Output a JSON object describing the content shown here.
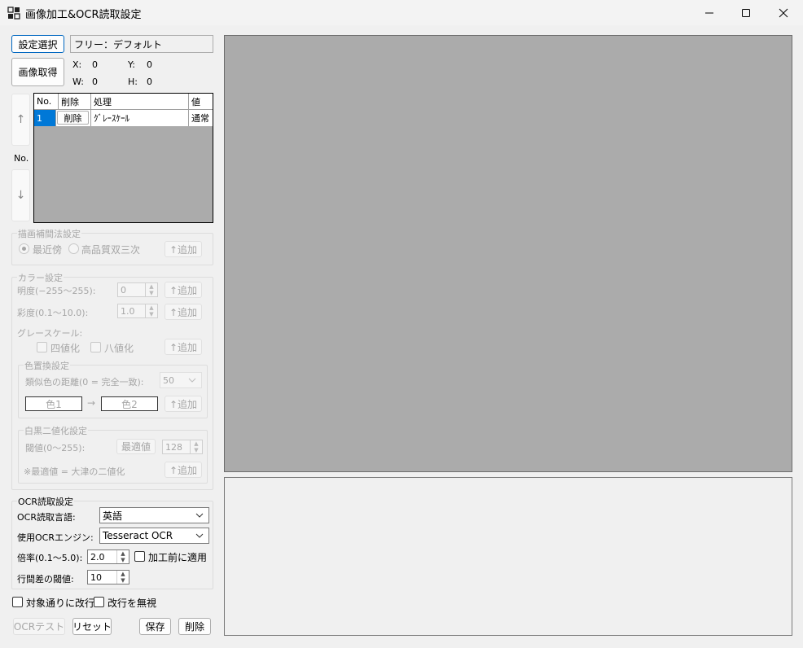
{
  "window": {
    "title": "画像加工&OCR読取設定"
  },
  "top": {
    "select_setting_button": "設定選択",
    "setting_name": "フリー：デフォルト",
    "capture_button": "画像取得",
    "x_label": "X:",
    "x_value": "0",
    "y_label": "Y:",
    "y_value": "0",
    "w_label": "W:",
    "w_value": "0",
    "h_label": "H:",
    "h_value": "0"
  },
  "order": {
    "up": "↑",
    "no_label": "No.",
    "down": "↓"
  },
  "steps_table": {
    "columns": [
      "No.",
      "削除",
      "処理",
      "値"
    ],
    "rows": [
      {
        "no": "1",
        "delete": "削除",
        "process": "ｸﾞﾚｰｽｹｰﾙ",
        "value": "通常"
      }
    ]
  },
  "interpolation": {
    "title": "描画補間法設定",
    "options": [
      "最近傍",
      "高品質双三次"
    ],
    "add_button": "↑追加"
  },
  "color": {
    "title": "カラー設定",
    "brightness_label": "明度(−255〜255):",
    "brightness_value": "0",
    "saturation_label": "彩度(0.1〜10.0):",
    "saturation_value": "1.0",
    "grayscale_label": "グレースケール:",
    "quad_label": "四値化",
    "oct_label": "八値化",
    "add_button": "↑追加",
    "replace": {
      "title": "色置換設定",
      "distance_label": "類似色の距離(0 = 完全一致):",
      "distance_value": "50",
      "color1": "色1",
      "arrow": "→",
      "color2": "色2"
    },
    "binarize": {
      "title": "白黒二値化設定",
      "threshold_label": "閾値(0〜255):",
      "optimal_button": "最適値",
      "threshold_value": "128",
      "note": "※最適値 = 大津の二値化"
    }
  },
  "ocr": {
    "title": "OCR読取設定",
    "language_label": "OCR読取言語:",
    "language_value": "英語",
    "engine_label": "使用OCRエンジン:",
    "engine_value": "Tesseract OCR",
    "scale_label": "倍率(0.1〜5.0):",
    "scale_value": "2.0",
    "apply_before_label": "加工前に適用",
    "line_gap_label": "行間差の閾値:",
    "line_gap_value": "10"
  },
  "options": {
    "newline_per_target": "対象通りに改行",
    "ignore_newline": "改行を無視"
  },
  "footer": {
    "ocr_test": "OCRテスト",
    "reset": "リセット",
    "save": "保存",
    "delete": "削除"
  },
  "colors": {
    "accent": "#0067c0",
    "preview_bg": "#ababab",
    "disabled_text": "#a6a6a6"
  }
}
